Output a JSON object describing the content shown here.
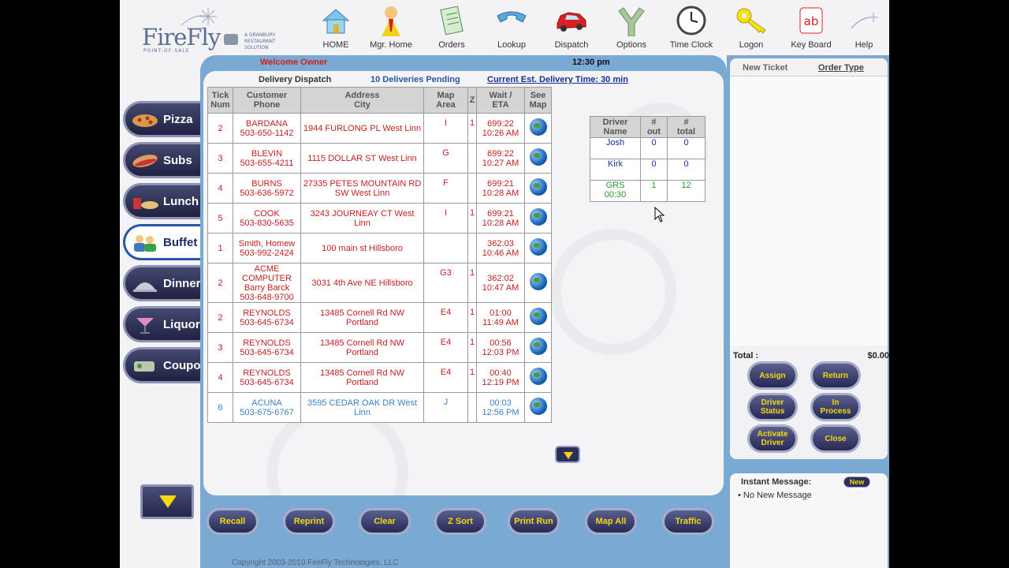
{
  "logo": {
    "name": "FireFly",
    "tagline": "POINT-OF-SALE",
    "vendor": "A GRANBURY RESTAURANT SOLUTION"
  },
  "topnav": [
    {
      "label": "HOME",
      "icon": "house-icon"
    },
    {
      "label": "Mgr. Home",
      "icon": "manager-icon"
    },
    {
      "label": "Orders",
      "icon": "notepad-icon"
    },
    {
      "label": "Lookup",
      "icon": "phone-icon"
    },
    {
      "label": "Dispatch",
      "icon": "car-icon"
    },
    {
      "label": "Options",
      "icon": "fork-road-icon"
    },
    {
      "label": "Time Clock",
      "icon": "clock-icon"
    },
    {
      "label": "Logon",
      "icon": "key-icon"
    },
    {
      "label": "Key Board",
      "icon": "keyboard-icon"
    },
    {
      "label": "Help",
      "icon": "help-icon"
    }
  ],
  "status": {
    "welcome": "Welcome Owner",
    "time": "12:30 pm"
  },
  "dispatch": {
    "title": "Delivery Dispatch",
    "pending": "10 Deliveries Pending",
    "est_time": "Current Est. Delivery Time: 30 min"
  },
  "deliveries": {
    "headers": [
      {
        "l1": "Tick",
        "l2": "Num"
      },
      {
        "l1": "Customer",
        "l2": "Phone"
      },
      {
        "l1": "Address",
        "l2": "City"
      },
      {
        "l1": "Map",
        "l2": "Area"
      },
      {
        "l1": "Z",
        "l2": ""
      },
      {
        "l1": "Wait /",
        "l2": "ETA"
      },
      {
        "l1": "See",
        "l2": "Map"
      }
    ],
    "rows": [
      {
        "tick": "2",
        "cust": [
          "BARDANA",
          "503-650-1142"
        ],
        "addr": [
          "1944 FURLONG PL West Linn"
        ],
        "area": "I",
        "z": "1",
        "wait": [
          "699:22",
          "10:26 AM"
        ],
        "color": "red"
      },
      {
        "tick": "3",
        "cust": [
          "BLEVIN",
          "503-655-4211"
        ],
        "addr": [
          "1115 DOLLAR ST West Linn"
        ],
        "area": "G",
        "z": "",
        "wait": [
          "699:22",
          "10:27 AM"
        ],
        "color": "red"
      },
      {
        "tick": "4",
        "cust": [
          "BURNS",
          "503-636-5972"
        ],
        "addr": [
          "27335 PETES MOUNTAIN RD",
          "SW West Linn"
        ],
        "area": "F",
        "z": "",
        "wait": [
          "699:21",
          "10:28 AM"
        ],
        "color": "red"
      },
      {
        "tick": "5",
        "cust": [
          "COOK",
          "503-830-5635"
        ],
        "addr": [
          "3243 JOURNEAY CT West",
          "Linn"
        ],
        "area": "I",
        "z": "1",
        "wait": [
          "699:21",
          "10:28 AM"
        ],
        "color": "red"
      },
      {
        "tick": "1",
        "cust": [
          "Smith, Homew",
          "503-992-2424"
        ],
        "addr": [
          "100 main st Hillsboro"
        ],
        "area": "",
        "z": "",
        "wait": [
          "362:03",
          "10:46 AM"
        ],
        "color": "red"
      },
      {
        "tick": "2",
        "cust": [
          "ACME",
          "COMPUTER",
          "Barry Barck",
          "503-648-9700"
        ],
        "addr": [
          "3031 4th Ave NE Hillsboro"
        ],
        "area": "G3",
        "z": "1",
        "wait": [
          "362:02",
          "10:47 AM"
        ],
        "color": "red"
      },
      {
        "tick": "2",
        "cust": [
          "REYNOLDS",
          "503-645-6734"
        ],
        "addr": [
          "13485 Cornell Rd NW",
          "Portland"
        ],
        "area": "E4",
        "z": "1",
        "wait": [
          "01:00",
          "11:49 AM"
        ],
        "color": "red"
      },
      {
        "tick": "3",
        "cust": [
          "REYNOLDS",
          "503-645-6734"
        ],
        "addr": [
          "13485 Cornell Rd NW",
          "Portland"
        ],
        "area": "E4",
        "z": "1",
        "wait": [
          "00:56",
          "12:03 PM"
        ],
        "color": "red"
      },
      {
        "tick": "4",
        "cust": [
          "REYNOLDS",
          "503-645-6734"
        ],
        "addr": [
          "13485 Cornell Rd NW",
          "Portland"
        ],
        "area": "E4",
        "z": "1",
        "wait": [
          "00:40",
          "12:19 PM"
        ],
        "color": "red"
      },
      {
        "tick": "6",
        "cust": [
          "ACUNA",
          "503-675-6767"
        ],
        "addr": [
          "3595 CEDAR OAK DR West",
          "Linn"
        ],
        "area": "J",
        "z": "",
        "wait": [
          "00:03",
          "12:56 PM"
        ],
        "color": "blue"
      }
    ]
  },
  "drivers": {
    "headers": [
      {
        "l1": "Driver",
        "l2": "Name"
      },
      {
        "l1": "#",
        "l2": "out"
      },
      {
        "l1": "#",
        "l2": "total"
      }
    ],
    "rows": [
      {
        "name": [
          "Josh"
        ],
        "out": "0",
        "total": "0",
        "color": "blue"
      },
      {
        "name": [
          "Kirk"
        ],
        "out": "0",
        "total": "0",
        "color": "blue"
      },
      {
        "name": [
          "GRS",
          "00:30"
        ],
        "out": "1",
        "total": "12",
        "color": "green"
      }
    ]
  },
  "categories": [
    {
      "label": "Pizza",
      "icon": "pizza-icon"
    },
    {
      "label": "Subs",
      "icon": "sub-sandwich-icon"
    },
    {
      "label": "Lunch",
      "icon": "lunch-icon"
    },
    {
      "label": "Buffet",
      "icon": "buffet-people-icon",
      "active": true
    },
    {
      "label": "Dinner",
      "icon": "cloche-icon"
    },
    {
      "label": "Liquor",
      "icon": "cocktail-icon"
    },
    {
      "label": "Coupo",
      "icon": "coupon-icon"
    }
  ],
  "bottom_buttons": [
    "Recall",
    "Reprint",
    "Clear",
    "Z Sort",
    "Print Run",
    "Map All",
    "Traffic"
  ],
  "copyright": "Copyright 2003-2010 FireFly Technologies, LLC",
  "ticket": {
    "new_ticket": "New Ticket",
    "order_type": "Order Type",
    "total_label": "Total :",
    "total_value": "$0.00"
  },
  "right_buttons": [
    {
      "label": [
        "Assign"
      ]
    },
    {
      "label": [
        "Return"
      ]
    },
    {
      "label": [
        "Driver",
        "Status"
      ]
    },
    {
      "label": [
        "In",
        "Process"
      ]
    },
    {
      "label": [
        "Activate",
        "Driver"
      ]
    },
    {
      "label": [
        "Close"
      ]
    }
  ],
  "im": {
    "label": "Instant Message:",
    "new_label": "New",
    "message": "• No New Message"
  },
  "colors": {
    "panel": "#7aa9d3",
    "button_text": "#f5d80f",
    "row_red": "#c41f1f",
    "row_blue": "#3d80c8",
    "driver_green": "#2a9a2a"
  }
}
